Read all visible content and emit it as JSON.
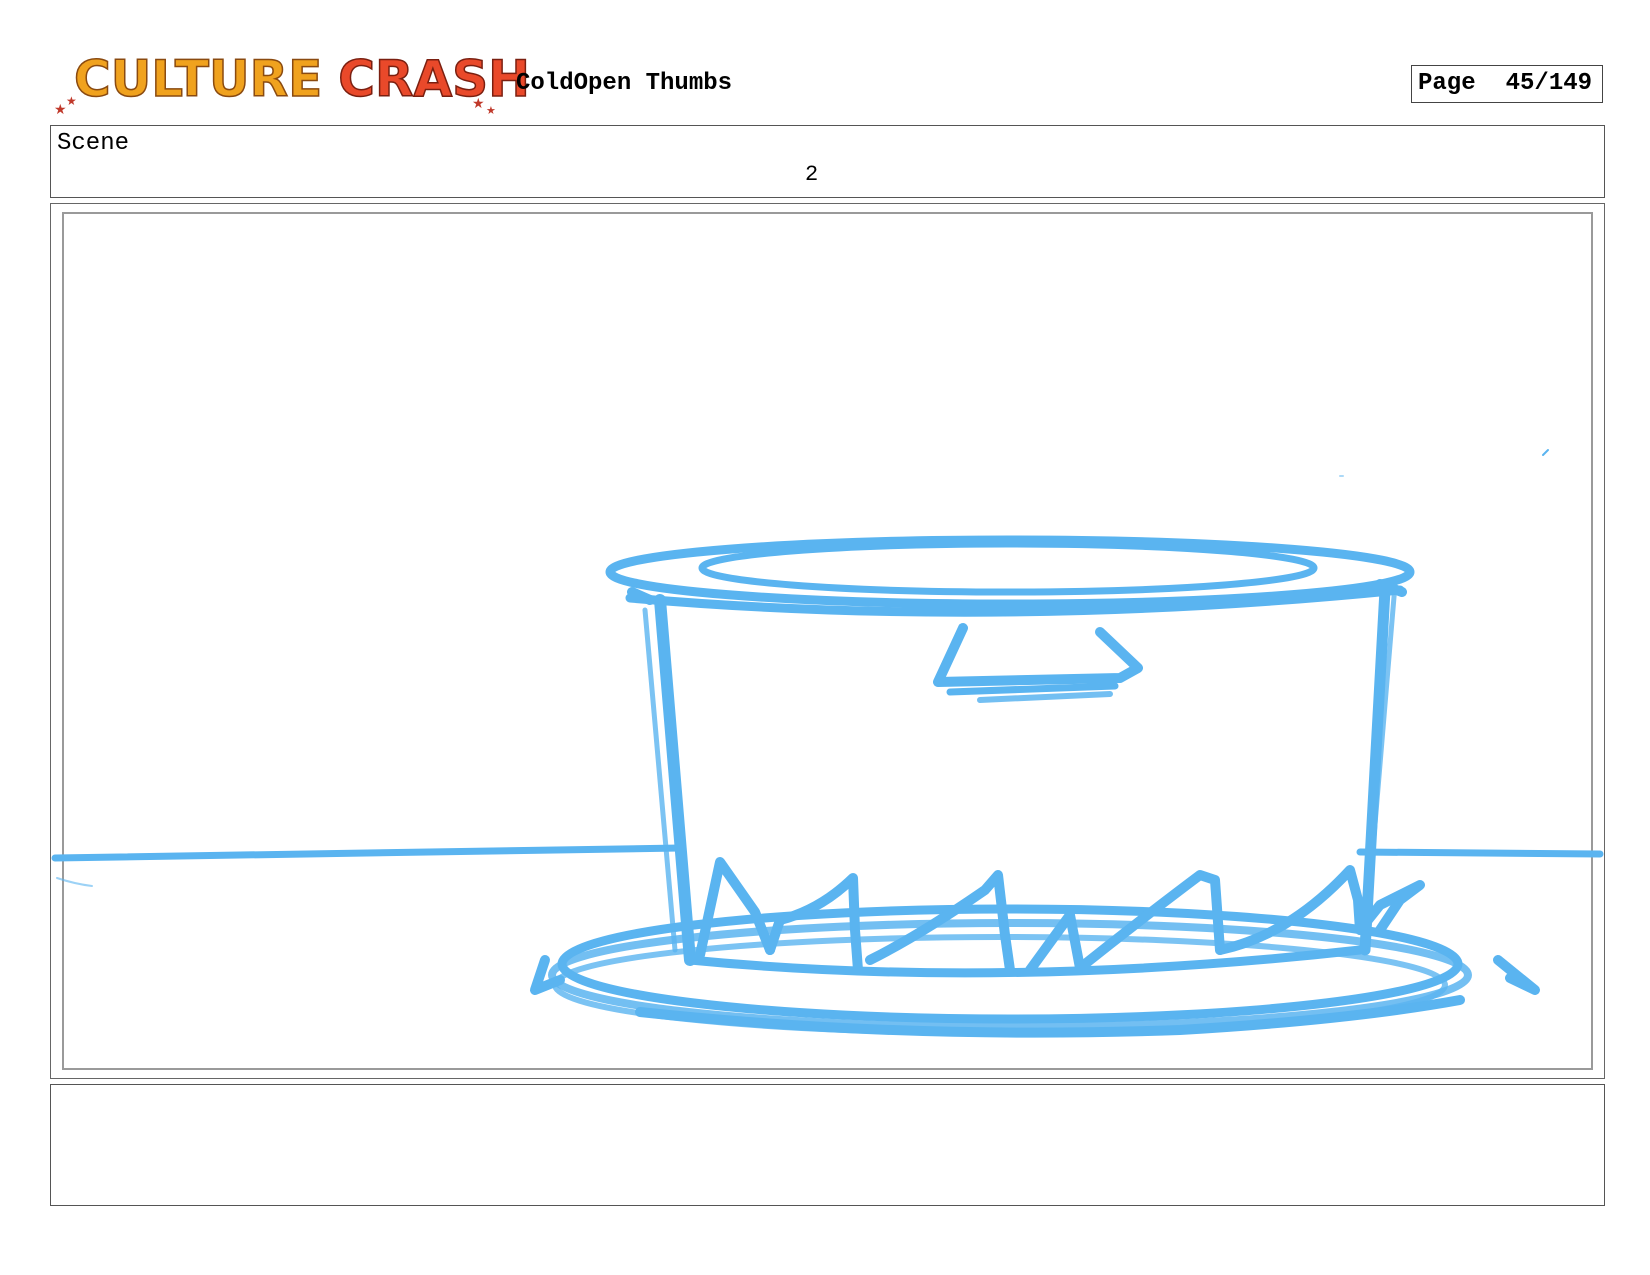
{
  "header": {
    "logo_word1": "CULTURE",
    "logo_word2": "CRASH",
    "document_title": "ColdOpen Thumbs",
    "page_label": "Page",
    "page_value": "45/149"
  },
  "scene": {
    "label": "Scene",
    "number": "2"
  },
  "panel": {
    "sketch_color": "#5ab4f0",
    "depicts": "pot-on-stove-burner-icon"
  },
  "notes": {
    "text": ""
  }
}
